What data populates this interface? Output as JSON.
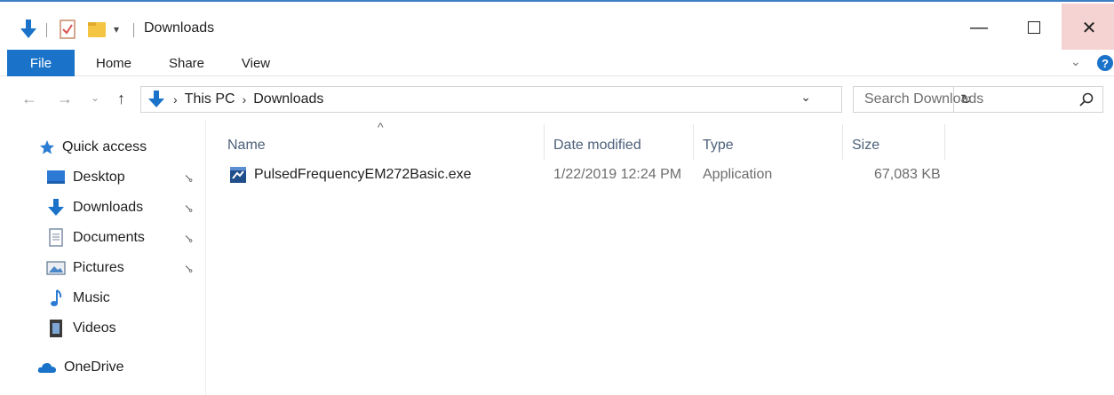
{
  "window": {
    "title": "Downloads",
    "minimize_glyph": "—",
    "close_glyph": "✕"
  },
  "ribbon": {
    "tabs": [
      "File",
      "Home",
      "Share",
      "View"
    ]
  },
  "nav": {
    "back_glyph": "←",
    "forward_glyph": "→",
    "recent_glyph": "⌄",
    "up_glyph": "↑",
    "breadcrumb": [
      "This PC",
      "Downloads"
    ],
    "separator": "›",
    "dropdown_glyph": "⌄",
    "refresh_glyph": "↻"
  },
  "search": {
    "placeholder": "Search Downloads"
  },
  "sidebar": {
    "items": [
      {
        "label": "Quick access",
        "icon": "star-icon",
        "pinned": false
      },
      {
        "label": "Desktop",
        "icon": "desktop-icon",
        "pinned": true
      },
      {
        "label": "Downloads",
        "icon": "download-icon",
        "pinned": true
      },
      {
        "label": "Documents",
        "icon": "documents-icon",
        "pinned": true
      },
      {
        "label": "Pictures",
        "icon": "pictures-icon",
        "pinned": true
      },
      {
        "label": "Music",
        "icon": "music-icon",
        "pinned": false
      },
      {
        "label": "Videos",
        "icon": "videos-icon",
        "pinned": false
      },
      {
        "label": "OneDrive",
        "icon": "onedrive-icon",
        "pinned": false
      }
    ],
    "pin_glyph": "📌"
  },
  "columns": {
    "name": "Name",
    "date": "Date modified",
    "type": "Type",
    "size": "Size",
    "sort_glyph": "^"
  },
  "files": [
    {
      "name": "PulsedFrequencyEM272Basic.exe",
      "date": "1/22/2019 12:24 PM",
      "type": "Application",
      "size": "67,083 KB"
    }
  ],
  "colors": {
    "accent": "#1a73c9",
    "close_hover": "#f6d3d3",
    "header_text": "#4c607a",
    "folder_yellow": "#f4c542"
  }
}
